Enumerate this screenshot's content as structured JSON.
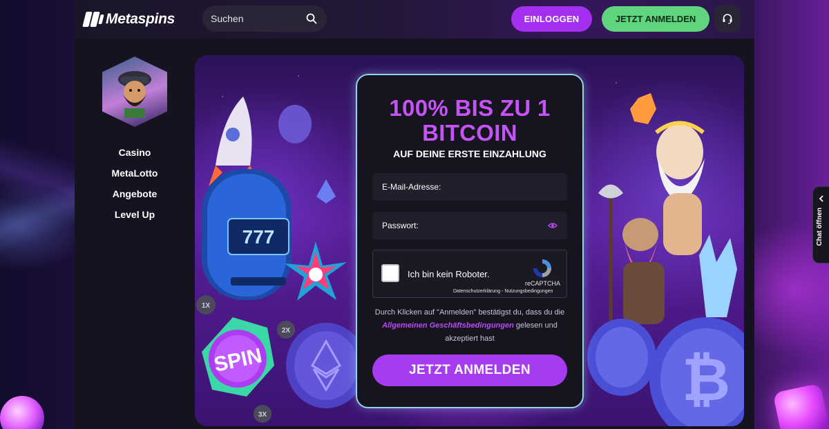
{
  "brand": {
    "name": "Metaspins"
  },
  "header": {
    "search_placeholder": "Suchen",
    "login_label": "EINLOGGEN",
    "register_label": "JETZT ANMELDEN"
  },
  "sidebar": {
    "items": [
      {
        "label": "Casino"
      },
      {
        "label": "MetaLotto"
      },
      {
        "label": "Angebote"
      },
      {
        "label": "Level Up"
      }
    ]
  },
  "card": {
    "headline_line1": "100% BIS ZU 1",
    "headline_line2": "BITCOIN",
    "subline": "AUF DEINE ERSTE EINZAHLUNG",
    "email_label": "E-Mail-Adresse:",
    "password_label": "Passwort:",
    "recaptcha": {
      "label": "Ich bin kein Roboter.",
      "brand": "reCAPTCHA",
      "links": "Datenschutzerklärung - Nutzungsbedingungen"
    },
    "terms_before": "Durch Klicken auf \"Anmelden\" bestätigst du, dass du die",
    "terms_link": "Allgemeinen Geschäftsbedingungen",
    "terms_after": "gelesen und akzeptiert hast",
    "cta_label": "JETZT ANMELDEN"
  },
  "banner_art": {
    "slot_reels": "777",
    "spin_label": "SPIN",
    "multipliers": [
      "1X",
      "2X",
      "3X"
    ]
  },
  "chat": {
    "label": "Chat öffnen"
  },
  "colors": {
    "accent_purple": "#a52ff0",
    "register_green": "#5fd57e",
    "card_border": "#8fd6e6"
  }
}
